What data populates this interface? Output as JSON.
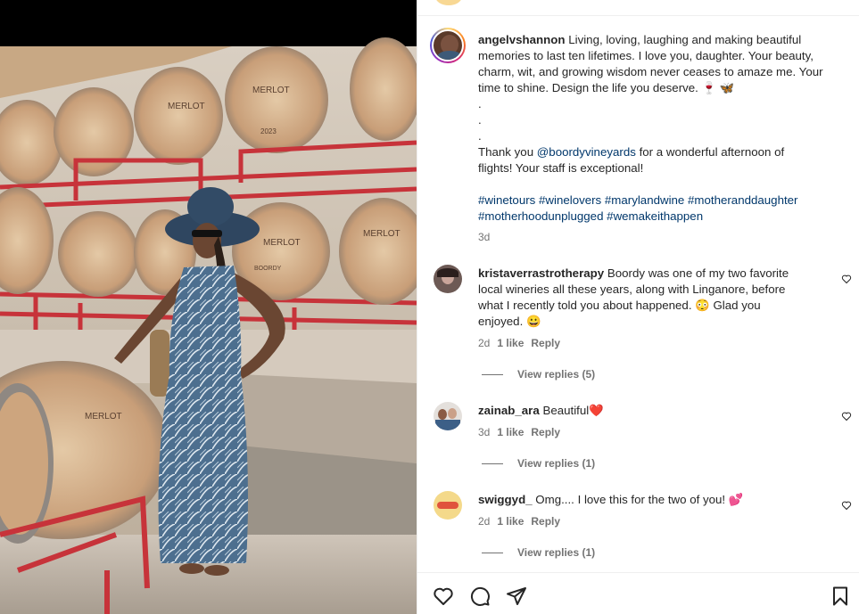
{
  "post": {
    "author": "angelvshannon",
    "caption_line1": " Living, loving, laughing and making beautiful",
    "caption_line2": "memories to last ten lifetimes. I love you, daughter. Your beauty,",
    "caption_line3": "charm, wit, and growing wisdom never ceases to amaze me. Your",
    "caption_line4": "time to shine. Design the life you deserve. 🍷 🦋",
    "dot1": ".",
    "dot2": ".",
    "dot3": ".",
    "thanks_a": "Thank you ",
    "thanks_mention": "@boordyvineyards",
    "thanks_b": " for a wonderful afternoon of",
    "thanks_line2": "flights! Your staff is exceptional!",
    "hashtags_line1": "#winetours #winelovers #marylandwine #motheranddaughter",
    "hashtags_line2": "#motherhoodunplugged #wemakeithappen",
    "time": "3d"
  },
  "photo": {
    "barrel_labels": [
      "MERLOT",
      "MERLOT",
      "MERLOT",
      "MERLOT",
      "MERLOT",
      "BOORDY"
    ],
    "barrel_year": "2023"
  },
  "comments": [
    {
      "user": "kristaverrastrotherapy",
      "line1": " Boordy was one of my two favorite",
      "line2": "local wineries all these years, along with Linganore, before",
      "line3": "what I recently told you about happened. 😳 Glad you",
      "line4": "enjoyed. 😀",
      "time": "2d",
      "likes": "1 like",
      "reply": "Reply",
      "view_replies": "View replies (5)"
    },
    {
      "user": "zainab_ara",
      "line1": " Beautiful❤️",
      "time": "3d",
      "likes": "1 like",
      "reply": "Reply",
      "view_replies": "View replies (1)"
    },
    {
      "user": "swiggyd_",
      "line1": " Omg.... I love this for the two of you! 💕",
      "time": "2d",
      "likes": "1 like",
      "reply": "Reply",
      "view_replies": "View replies (1)"
    }
  ],
  "icons": {
    "like": "heart-icon",
    "comment": "comment-icon",
    "share": "send-icon",
    "save": "bookmark-icon"
  }
}
